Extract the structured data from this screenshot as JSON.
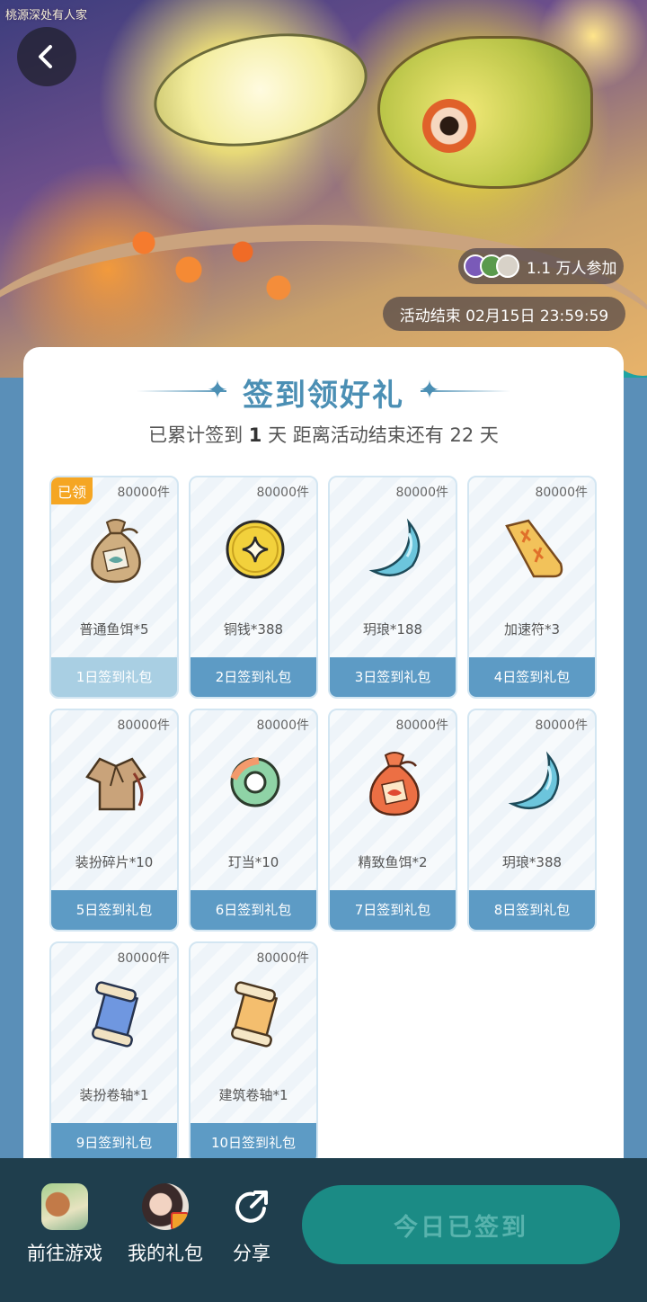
{
  "banner": {
    "logo_text": "桃源深处有人家",
    "participants": "1.1 万人参加",
    "end_time": "活动结束 02月15日 23:59:59"
  },
  "card": {
    "title": "签到领好礼",
    "subtitle_prefix": "已累计签到",
    "signed_days": "1",
    "subtitle_mid": "天  距离活动结束还有",
    "days_left": "22",
    "subtitle_suffix": "天"
  },
  "rewards": [
    {
      "stock": "80000件",
      "name": "普通鱼饵*5",
      "day": "1日签到礼包",
      "claimed": "已领",
      "icon": "fish-bait-bag-icon"
    },
    {
      "stock": "80000件",
      "name": "铜钱*388",
      "day": "2日签到礼包",
      "icon": "copper-coin-icon"
    },
    {
      "stock": "80000件",
      "name": "玥琅*188",
      "day": "3日签到礼包",
      "icon": "crescent-moon-icon"
    },
    {
      "stock": "80000件",
      "name": "加速符*3",
      "day": "4日签到礼包",
      "icon": "talisman-icon"
    },
    {
      "stock": "80000件",
      "name": "装扮碎片*10",
      "day": "5日签到礼包",
      "icon": "clothing-fragment-icon"
    },
    {
      "stock": "80000件",
      "name": "玎当*10",
      "day": "6日签到礼包",
      "icon": "jade-ring-icon"
    },
    {
      "stock": "80000件",
      "name": "精致鱼饵*2",
      "day": "7日签到礼包",
      "icon": "fine-bait-bag-icon"
    },
    {
      "stock": "80000件",
      "name": "玥琅*388",
      "day": "8日签到礼包",
      "icon": "crescent-moon-icon"
    },
    {
      "stock": "80000件",
      "name": "装扮卷轴*1",
      "day": "9日签到礼包",
      "icon": "blue-scroll-icon"
    },
    {
      "stock": "80000件",
      "name": "建筑卷轴*1",
      "day": "10日签到礼包",
      "icon": "orange-scroll-icon"
    }
  ],
  "bottom_bar": {
    "go_game": "前往游戏",
    "my_gifts": "我的礼包",
    "share": "分享",
    "signed_today": "今日已签到"
  },
  "colors": {
    "accent": "#4b8fb4",
    "day_button": "#5d9bc5",
    "claimed_badge": "#f5a623",
    "bottom_bar": "#1f3e4d",
    "signed_button": "#1b8b85"
  }
}
